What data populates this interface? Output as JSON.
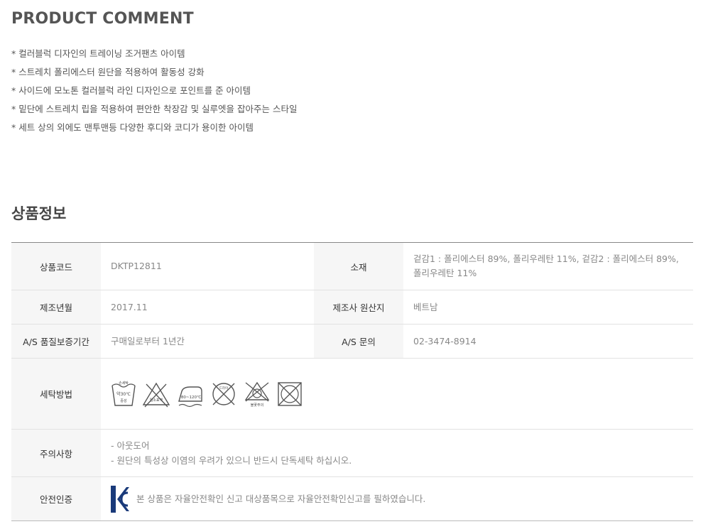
{
  "comment_title": "PRODUCT COMMENT",
  "comments": [
    "* 컬러블럭 디자인의 트레이닝 조거팬츠 아이템",
    "* 스트레치 폴리에스터 원단을 적용하여 활동성 강화",
    "* 사이드에 모노톤 컬러블럭 라인 디자인으로 포인트를 준 아이템",
    "* 밑단에 스트레치 립을 적용하여 편안한 착장감 및 실루엣을 잡아주는 스타일",
    "* 세트 상의 외에도 맨투맨등 다양한 후디와 코디가 용이한 아이템"
  ],
  "info_title": "상품정보",
  "spec": {
    "code_label": "상품코드",
    "code_value": "DKTP12811",
    "material_label": "소재",
    "material_value": "겉감1 : 폴리에스터 89%, 폴리우레탄 11%, 겉감2 : 폴리에스터 89%, 폴리우레탄 11%",
    "date_label": "제조년월",
    "date_value": "2017.11",
    "origin_label": "제조사 원산지",
    "origin_value": "베트남",
    "warranty_label": "A/S 품질보증기간",
    "warranty_value": "구매일로부터 1년간",
    "as_label": "A/S 문의",
    "as_value": "02-3474-8914",
    "wash_label": "세탁방법",
    "wash_icons": {
      "hand_wash_top": "손세탁",
      "hand_wash_temp": "약30℃",
      "hand_wash_bottom": "중성",
      "bleach_text": "염소표백",
      "iron_text": "80~120℃",
      "dry_clean_text": "드라이",
      "dryer_text": "불꽃주의"
    },
    "caution_label": "주의사항",
    "caution_lines": [
      "- 아웃도어",
      "- 원단의 특성상 이염의 우려가 있으니 반드시 단독세탁 하십시오."
    ],
    "safety_label": "안전인증",
    "safety_text": "본 상품은 자율안전확인 신고 대상품목으로 자율안전확인신고를 필하였습니다."
  }
}
